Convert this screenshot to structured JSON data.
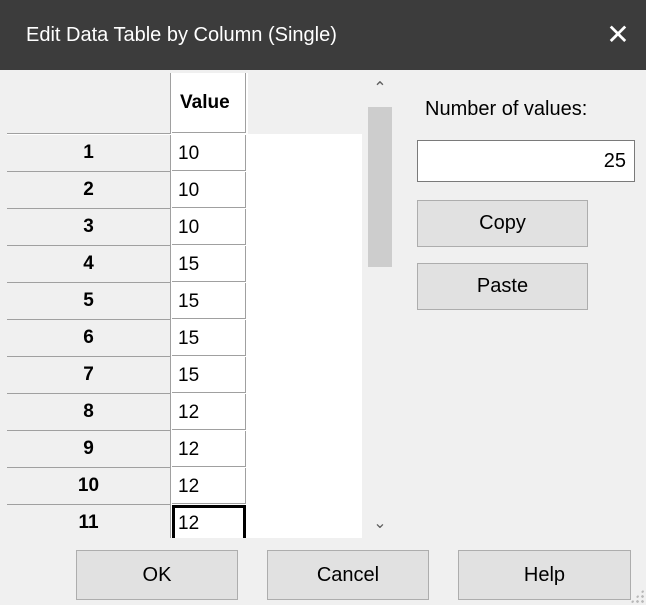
{
  "window": {
    "title": "Edit Data Table by Column (Single)",
    "close_glyph": "✕"
  },
  "grid": {
    "column_header": "Value",
    "rows": [
      {
        "label": "1",
        "value": "10"
      },
      {
        "label": "2",
        "value": "10"
      },
      {
        "label": "3",
        "value": "10"
      },
      {
        "label": "4",
        "value": "15"
      },
      {
        "label": "5",
        "value": "15"
      },
      {
        "label": "6",
        "value": "15"
      },
      {
        "label": "7",
        "value": "15"
      },
      {
        "label": "8",
        "value": "12"
      },
      {
        "label": "9",
        "value": "12"
      },
      {
        "label": "10",
        "value": "12"
      },
      {
        "label": "11",
        "value": "12"
      }
    ],
    "scroll_up_glyph": "⌃",
    "scroll_down_glyph": "⌄"
  },
  "side_panel": {
    "count_label": "Number of values:",
    "count_value": "25",
    "copy_label": "Copy",
    "paste_label": "Paste"
  },
  "footer": {
    "ok_label": "OK",
    "cancel_label": "Cancel",
    "help_label": "Help"
  }
}
